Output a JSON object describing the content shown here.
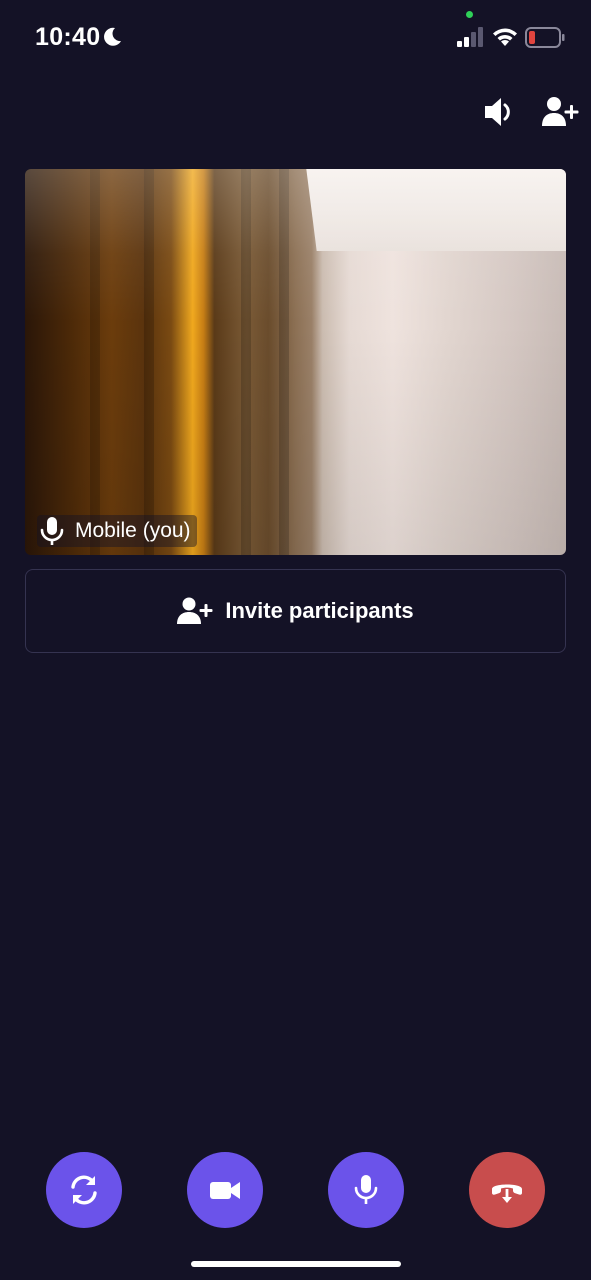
{
  "status_bar": {
    "time": "10:40",
    "icons": [
      "moon-icon",
      "signal-icon",
      "wifi-icon",
      "battery-icon"
    ],
    "battery_color": "#e0443e",
    "privacy_dot_color": "#2fd158"
  },
  "top_actions": {
    "icons": [
      "speaker-icon",
      "add-person-icon"
    ]
  },
  "video": {
    "participant_label": "Mobile (you)",
    "label_icon": "microphone-icon"
  },
  "invite": {
    "label": "Invite participants",
    "icon": "add-person-icon"
  },
  "controls": {
    "buttons": [
      {
        "name": "flip-camera",
        "icon": "camera-switch-icon",
        "color": "#6b53ea"
      },
      {
        "name": "video-toggle",
        "icon": "video-camera-icon",
        "color": "#6b53ea"
      },
      {
        "name": "mic-toggle",
        "icon": "microphone-icon",
        "color": "#6b53ea"
      },
      {
        "name": "end-call",
        "icon": "hang-up-icon",
        "color": "#c84d4d"
      }
    ]
  },
  "colors": {
    "background": "#141226",
    "accent": "#6b53ea",
    "danger": "#c84d4d",
    "border": "#353350"
  }
}
